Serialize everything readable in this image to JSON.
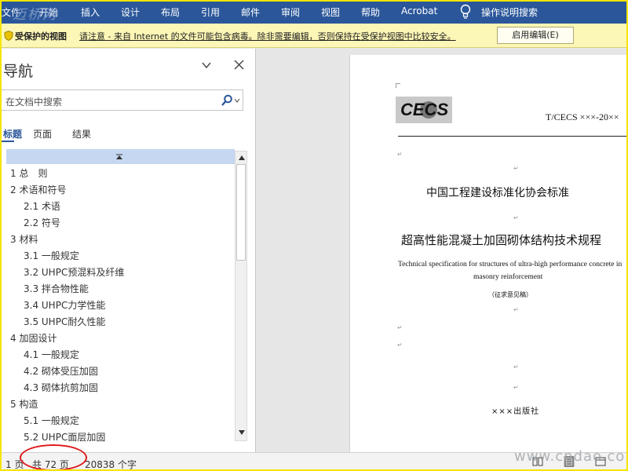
{
  "ribbon": {
    "tabs": [
      "文件",
      "开始",
      "插入",
      "设计",
      "布局",
      "引用",
      "邮件",
      "审阅",
      "视图",
      "帮助",
      "Acrobat"
    ],
    "tell_me": "操作说明搜索",
    "watermark": "迈桥网",
    "bg_color": "#2b579a"
  },
  "protected_view": {
    "title": "受保护的视图",
    "message": "请注意 - 来自 Internet 的文件可能包含病毒。除非需要编辑，否则保持在受保护视图中比较安全。",
    "enable_button": "启用编辑(E)",
    "bg_color": "#fcf7b6"
  },
  "nav": {
    "title": "导航",
    "search_placeholder": "在文档中搜索",
    "tabs": [
      "标题",
      "页面",
      "结果"
    ],
    "active_tab": "标题",
    "headings": [
      {
        "label": "1 总　则",
        "level": 1
      },
      {
        "label": "2 术语和符号",
        "level": 1
      },
      {
        "label": "2.1 术语",
        "level": 2
      },
      {
        "label": "2.2 符号",
        "level": 2
      },
      {
        "label": "3 材料",
        "level": 1
      },
      {
        "label": "3.1 一般规定",
        "level": 2
      },
      {
        "label": "3.2 UHPC预混料及纤维",
        "level": 2
      },
      {
        "label": "3.3 拌合物性能",
        "level": 2
      },
      {
        "label": "3.4 UHPC力学性能",
        "level": 2
      },
      {
        "label": "3.5 UHPC耐久性能",
        "level": 2
      },
      {
        "label": "4 加固设计",
        "level": 1
      },
      {
        "label": "4.1 一般规定",
        "level": 2
      },
      {
        "label": "4.2 砌体受压加固",
        "level": 2
      },
      {
        "label": "4.3 砌体抗剪加固",
        "level": 2
      },
      {
        "label": "5 构造",
        "level": 1
      },
      {
        "label": "5.1 一般规定",
        "level": 2
      },
      {
        "label": "5.2 UHPC面层加固",
        "level": 2
      }
    ]
  },
  "document": {
    "logo_text": "CECS",
    "code": "T/CECS ×××-20××",
    "association_title": "中国工程建设标准化协会标准",
    "main_title": "超高性能混凝土加固砌体结构技术规程",
    "english_title_line1": "Technical specification for structures of ultra-high performance concrete in",
    "english_title_line2": "masonry reinforcement",
    "draft_note": "（征求意见稿）",
    "publisher": "×××出版社"
  },
  "status": {
    "page": "1 页",
    "total_pages": "共 72 页",
    "word_count": "20838 个字",
    "watermark": "www.cndao.com"
  }
}
